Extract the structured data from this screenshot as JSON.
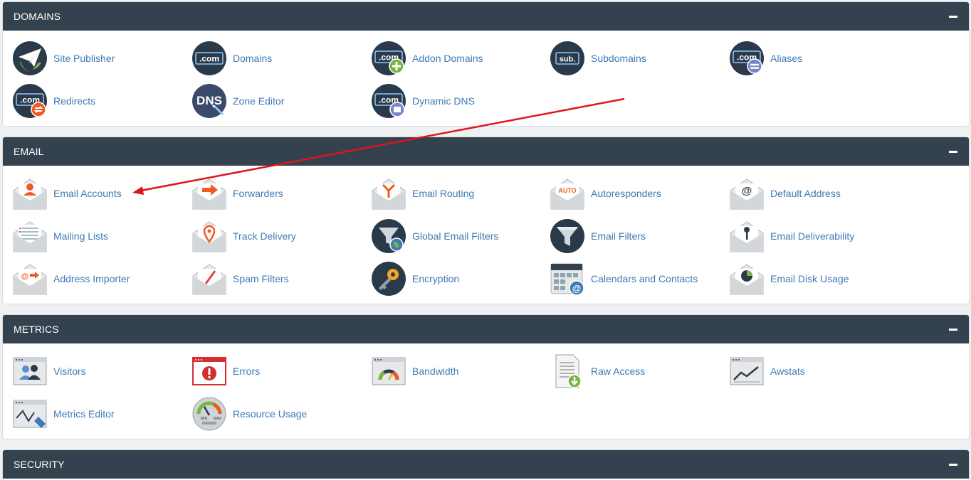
{
  "sections": [
    {
      "key": "domains",
      "title": "DOMAINS",
      "items": [
        {
          "label": "Site Publisher",
          "icon": "paper-plane-globe-icon"
        },
        {
          "label": "Domains",
          "icon": "dotcom-icon"
        },
        {
          "label": "Addon Domains",
          "icon": "dotcom-plus-icon"
        },
        {
          "label": "Subdomains",
          "icon": "sub-domain-icon"
        },
        {
          "label": "Aliases",
          "icon": "dotcom-equals-icon"
        },
        {
          "label": "Redirects",
          "icon": "dotcom-redirect-icon"
        },
        {
          "label": "Zone Editor",
          "icon": "dns-icon"
        },
        {
          "label": "Dynamic DNS",
          "icon": "dotcom-dns-icon"
        }
      ]
    },
    {
      "key": "email",
      "title": "EMAIL",
      "items": [
        {
          "label": "Email Accounts",
          "icon": "envelope-user-icon"
        },
        {
          "label": "Forwarders",
          "icon": "envelope-arrow-icon"
        },
        {
          "label": "Email Routing",
          "icon": "envelope-route-icon"
        },
        {
          "label": "Autoresponders",
          "icon": "envelope-auto-icon"
        },
        {
          "label": "Default Address",
          "icon": "envelope-at-icon"
        },
        {
          "label": "Mailing Lists",
          "icon": "envelope-list-icon"
        },
        {
          "label": "Track Delivery",
          "icon": "envelope-pin-icon"
        },
        {
          "label": "Global Email Filters",
          "icon": "funnel-globe-icon"
        },
        {
          "label": "Email Filters",
          "icon": "funnel-icon"
        },
        {
          "label": "Email Deliverability",
          "icon": "envelope-key-icon"
        },
        {
          "label": "Address Importer",
          "icon": "envelope-import-icon"
        },
        {
          "label": "Spam Filters",
          "icon": "envelope-pen-icon"
        },
        {
          "label": "Encryption",
          "icon": "key-icon"
        },
        {
          "label": "Calendars and Contacts",
          "icon": "calendar-at-icon"
        },
        {
          "label": "Email Disk Usage",
          "icon": "envelope-pie-icon"
        }
      ],
      "auto_text": "AUTO"
    },
    {
      "key": "metrics",
      "title": "METRICS",
      "items": [
        {
          "label": "Visitors",
          "icon": "visitors-icon"
        },
        {
          "label": "Errors",
          "icon": "error-window-icon"
        },
        {
          "label": "Bandwidth",
          "icon": "gauge-window-icon"
        },
        {
          "label": "Raw Access",
          "icon": "document-download-icon"
        },
        {
          "label": "Awstats",
          "icon": "line-chart-window-icon"
        },
        {
          "label": "Metrics Editor",
          "icon": "chart-edit-icon"
        },
        {
          "label": "Resource Usage",
          "icon": "gauge-min-max-icon"
        }
      ]
    },
    {
      "key": "security",
      "title": "SECURITY",
      "items": []
    }
  ],
  "icon_text": {
    "com": ".com",
    "sub": "sub.",
    "dns": "DNS",
    "min": "MIN",
    "max": "MAX"
  },
  "colors": {
    "header_bg": "#34414f",
    "link": "#3e7ab5",
    "annotation_arrow": "#e0141b",
    "icon_dark": "#2b3a4a",
    "icon_orange": "#f05a22",
    "icon_green": "#7cb342"
  }
}
